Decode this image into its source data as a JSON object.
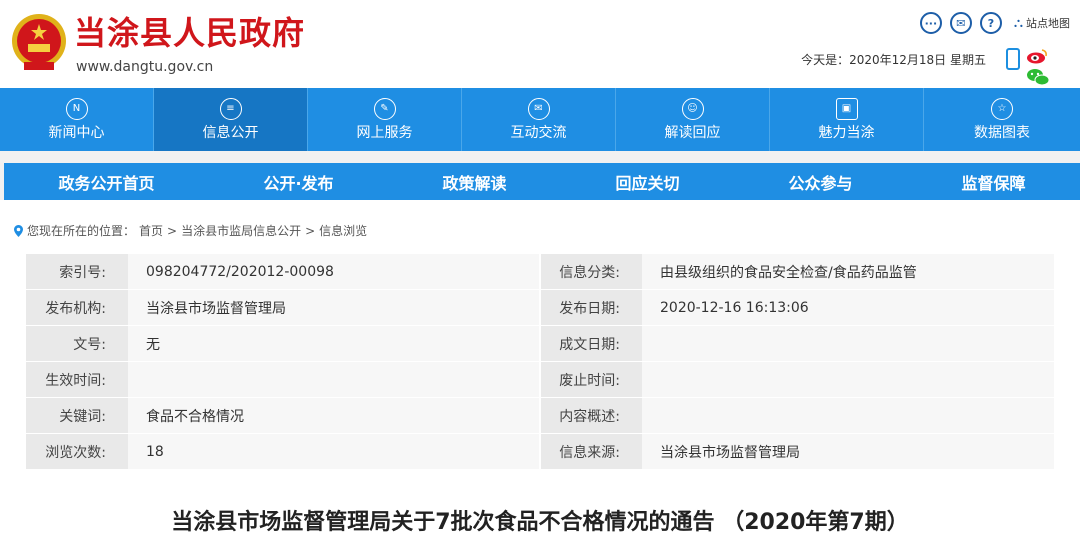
{
  "header": {
    "site_title": "当涂县人民政府",
    "site_url": "www.dangtu.gov.cn",
    "date_text": "今天是：2020年12月18日 星期五",
    "sitemap_label": "站点地图",
    "brand_color": "#d0161b",
    "icons": [
      "chat-icon",
      "mail-icon",
      "help-icon",
      "sitemap-icon",
      "phone-icon",
      "weibo-icon",
      "wechat-icon"
    ]
  },
  "mainnav": {
    "items": [
      {
        "label": "新闻中心",
        "icon": "news-icon"
      },
      {
        "label": "信息公开",
        "icon": "document-icon"
      },
      {
        "label": "网上服务",
        "icon": "pen-icon"
      },
      {
        "label": "互动交流",
        "icon": "mail-icon"
      },
      {
        "label": "解读回应",
        "icon": "chat-icon"
      },
      {
        "label": "魅力当涂",
        "icon": "image-icon"
      },
      {
        "label": "数据图表",
        "icon": "star-icon"
      }
    ],
    "active_index": 1,
    "color": "#1f8ee3"
  },
  "subnav": {
    "items": [
      "政务公开首页",
      "公开·发布",
      "政策解读",
      "回应关切",
      "公众参与",
      "监督保障"
    ]
  },
  "breadcrumb": {
    "prefix": "您现在所在的位置：",
    "items": [
      "首页",
      "当涂县市监局信息公开",
      "信息浏览"
    ],
    "separator": ">"
  },
  "info": {
    "rows": [
      {
        "l1": "索引号:",
        "v1": "098204772/202012-00098",
        "l2": "信息分类:",
        "v2": "由县级组织的食品安全检查/食品药品监管"
      },
      {
        "l1": "发布机构:",
        "v1": "当涂县市场监督管理局",
        "l2": "发布日期:",
        "v2": "2020-12-16 16:13:06"
      },
      {
        "l1": "文号:",
        "v1": "无",
        "l2": "成文日期:",
        "v2": ""
      },
      {
        "l1": "生效时间:",
        "v1": "",
        "l2": "废止时间:",
        "v2": ""
      },
      {
        "l1": "关键词:",
        "v1": "食品不合格情况",
        "l2": "内容概述:",
        "v2": ""
      },
      {
        "l1": "浏览次数:",
        "v1": "18",
        "l2": "信息来源:",
        "v2": "当涂县市场监督管理局"
      }
    ]
  },
  "article": {
    "title": "当涂县市场监督管理局关于7批次食品不合格情况的通告 （2020年第7期）"
  }
}
